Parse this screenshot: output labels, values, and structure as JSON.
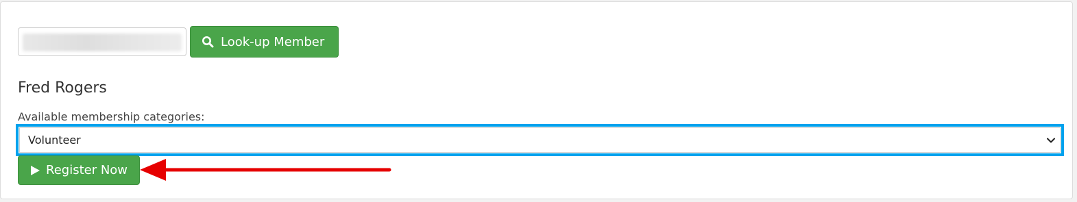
{
  "lookup": {
    "input_value": "",
    "button_label": "Look-up Member"
  },
  "member": {
    "name": "Fred Rogers"
  },
  "membership": {
    "label": "Available membership categories:",
    "selected": "Volunteer"
  },
  "register": {
    "button_label": "Register Now"
  },
  "colors": {
    "button_green": "#4aa54a",
    "highlight_blue": "#00a2ed",
    "annotation_red": "#e60000"
  },
  "icons": {
    "lookup": "search-icon",
    "register": "play-icon",
    "select": "chevron-down-icon",
    "annotation": "red-arrow"
  }
}
